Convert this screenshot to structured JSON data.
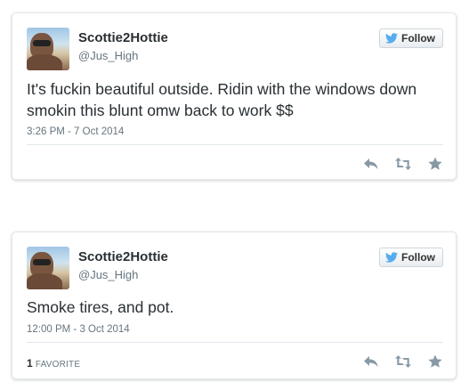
{
  "colors": {
    "text": "#292f33",
    "muted": "#66757f",
    "action_icon": "#8899a6",
    "bird": "#55acee"
  },
  "tweets": [
    {
      "display_name": "Scottie2Hottie",
      "handle": "@Jus_High",
      "follow_label": "Follow",
      "text": "It's fuckin beautiful outside. Ridin with the windows down\nsmokin this blunt omw back to work $$",
      "timestamp": "3:26 PM - 7 Oct 2014"
    },
    {
      "display_name": "Scottie2Hottie",
      "handle": "@Jus_High",
      "follow_label": "Follow",
      "text": "Smoke tires, and pot.",
      "timestamp": "12:00 PM - 3 Oct 2014",
      "favorites_count": "1",
      "favorites_label": "FAVORITE"
    }
  ],
  "icons": {
    "follow": "twitter-bird-icon",
    "reply": "reply-icon",
    "retweet": "retweet-icon",
    "favorite": "star-icon"
  }
}
